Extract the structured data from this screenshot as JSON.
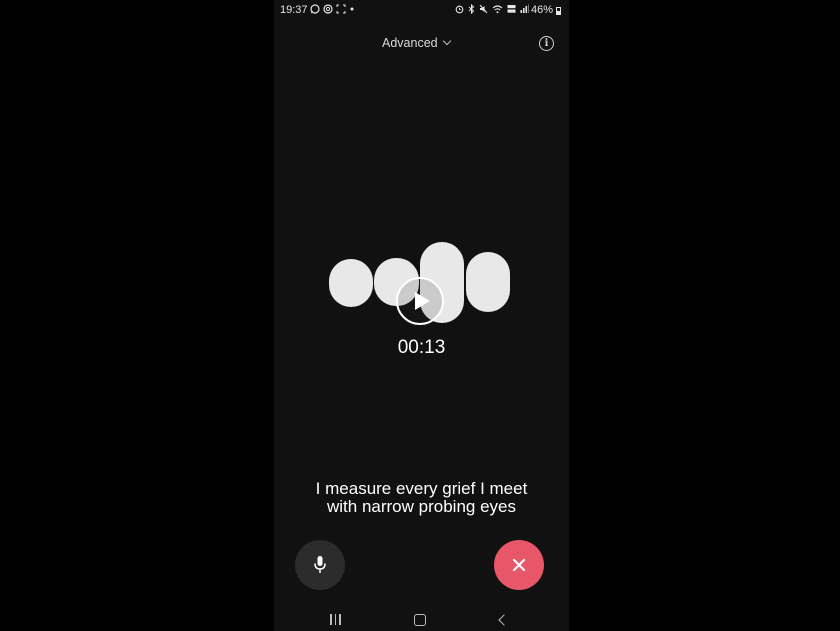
{
  "status_bar": {
    "time": "19:37",
    "battery": "46%",
    "left_icons": [
      "whatsapp-icon",
      "threads-icon",
      "screenshot-icon",
      "dot-icon"
    ],
    "right_icons": [
      "alarm-icon",
      "bluetooth-icon",
      "mute-icon",
      "wifi-icon",
      "volte-icon",
      "signal-icon"
    ]
  },
  "header": {
    "mode_label": "Advanced",
    "info_icon": "info-icon"
  },
  "player": {
    "timer": "00:13",
    "play_icon": "play-icon"
  },
  "caption": {
    "line1": "I measure every grief I meet",
    "line2": "with narrow probing eyes"
  },
  "controls": {
    "mic_icon": "microphone-icon",
    "end_icon": "close-icon",
    "end_color": "#e8566a",
    "mic_bg": "#2c2c2c"
  },
  "nav_bar": {
    "items": [
      "recent-apps-icon",
      "home-icon",
      "back-icon"
    ]
  }
}
